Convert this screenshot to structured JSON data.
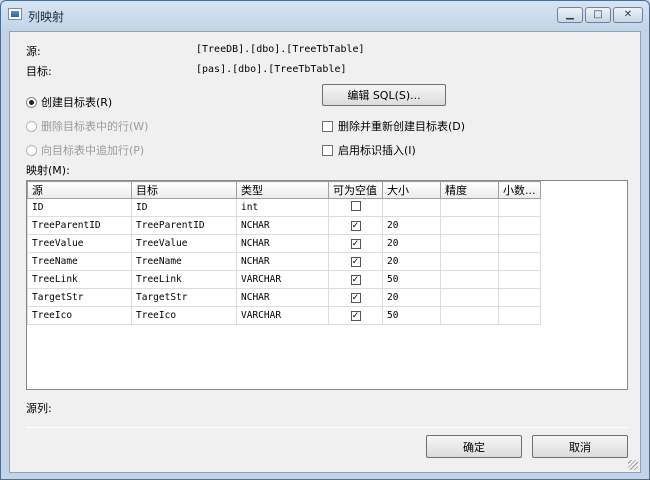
{
  "window": {
    "title": "列映射"
  },
  "info": {
    "source_label": "源:",
    "source_value": "[TreeDB].[dbo].[TreeTbTable]",
    "target_label": "目标:",
    "target_value": "[pas].[dbo].[TreeTbTable]"
  },
  "options": {
    "create_table": "创建目标表(R)",
    "delete_rows": "删除目标表中的行(W)",
    "append_rows": "向目标表中追加行(P)",
    "edit_sql": "编辑 SQL(S)...",
    "drop_recreate": "删除并重新创建目标表(D)",
    "identity_insert": "启用标识插入(I)"
  },
  "mapping": {
    "label": "映射(M):",
    "columns": [
      "源",
      "目标",
      "类型",
      "可为空值",
      "大小",
      "精度",
      "小数..."
    ],
    "rows": [
      {
        "source": "ID",
        "target": "ID",
        "type": "int",
        "nullable": false,
        "size": "",
        "precision": "",
        "scale": ""
      },
      {
        "source": "TreeParentID",
        "target": "TreeParentID",
        "type": "NCHAR",
        "nullable": true,
        "size": "20",
        "precision": "",
        "scale": ""
      },
      {
        "source": "TreeValue",
        "target": "TreeValue",
        "type": "NCHAR",
        "nullable": true,
        "size": "20",
        "precision": "",
        "scale": ""
      },
      {
        "source": "TreeName",
        "target": "TreeName",
        "type": "NCHAR",
        "nullable": true,
        "size": "20",
        "precision": "",
        "scale": ""
      },
      {
        "source": "TreeLink",
        "target": "TreeLink",
        "type": "VARCHAR",
        "nullable": true,
        "size": "50",
        "precision": "",
        "scale": ""
      },
      {
        "source": "TargetStr",
        "target": "TargetStr",
        "type": "NCHAR",
        "nullable": true,
        "size": "20",
        "precision": "",
        "scale": ""
      },
      {
        "source": "TreeIco",
        "target": "TreeIco",
        "type": "VARCHAR",
        "nullable": true,
        "size": "50",
        "precision": "",
        "scale": ""
      }
    ]
  },
  "footer": {
    "source_column_label": "源列:",
    "ok": "确定",
    "cancel": "取消"
  },
  "colors": {
    "titlebar": "#c3d4e8",
    "client": "#f0f0f0"
  }
}
